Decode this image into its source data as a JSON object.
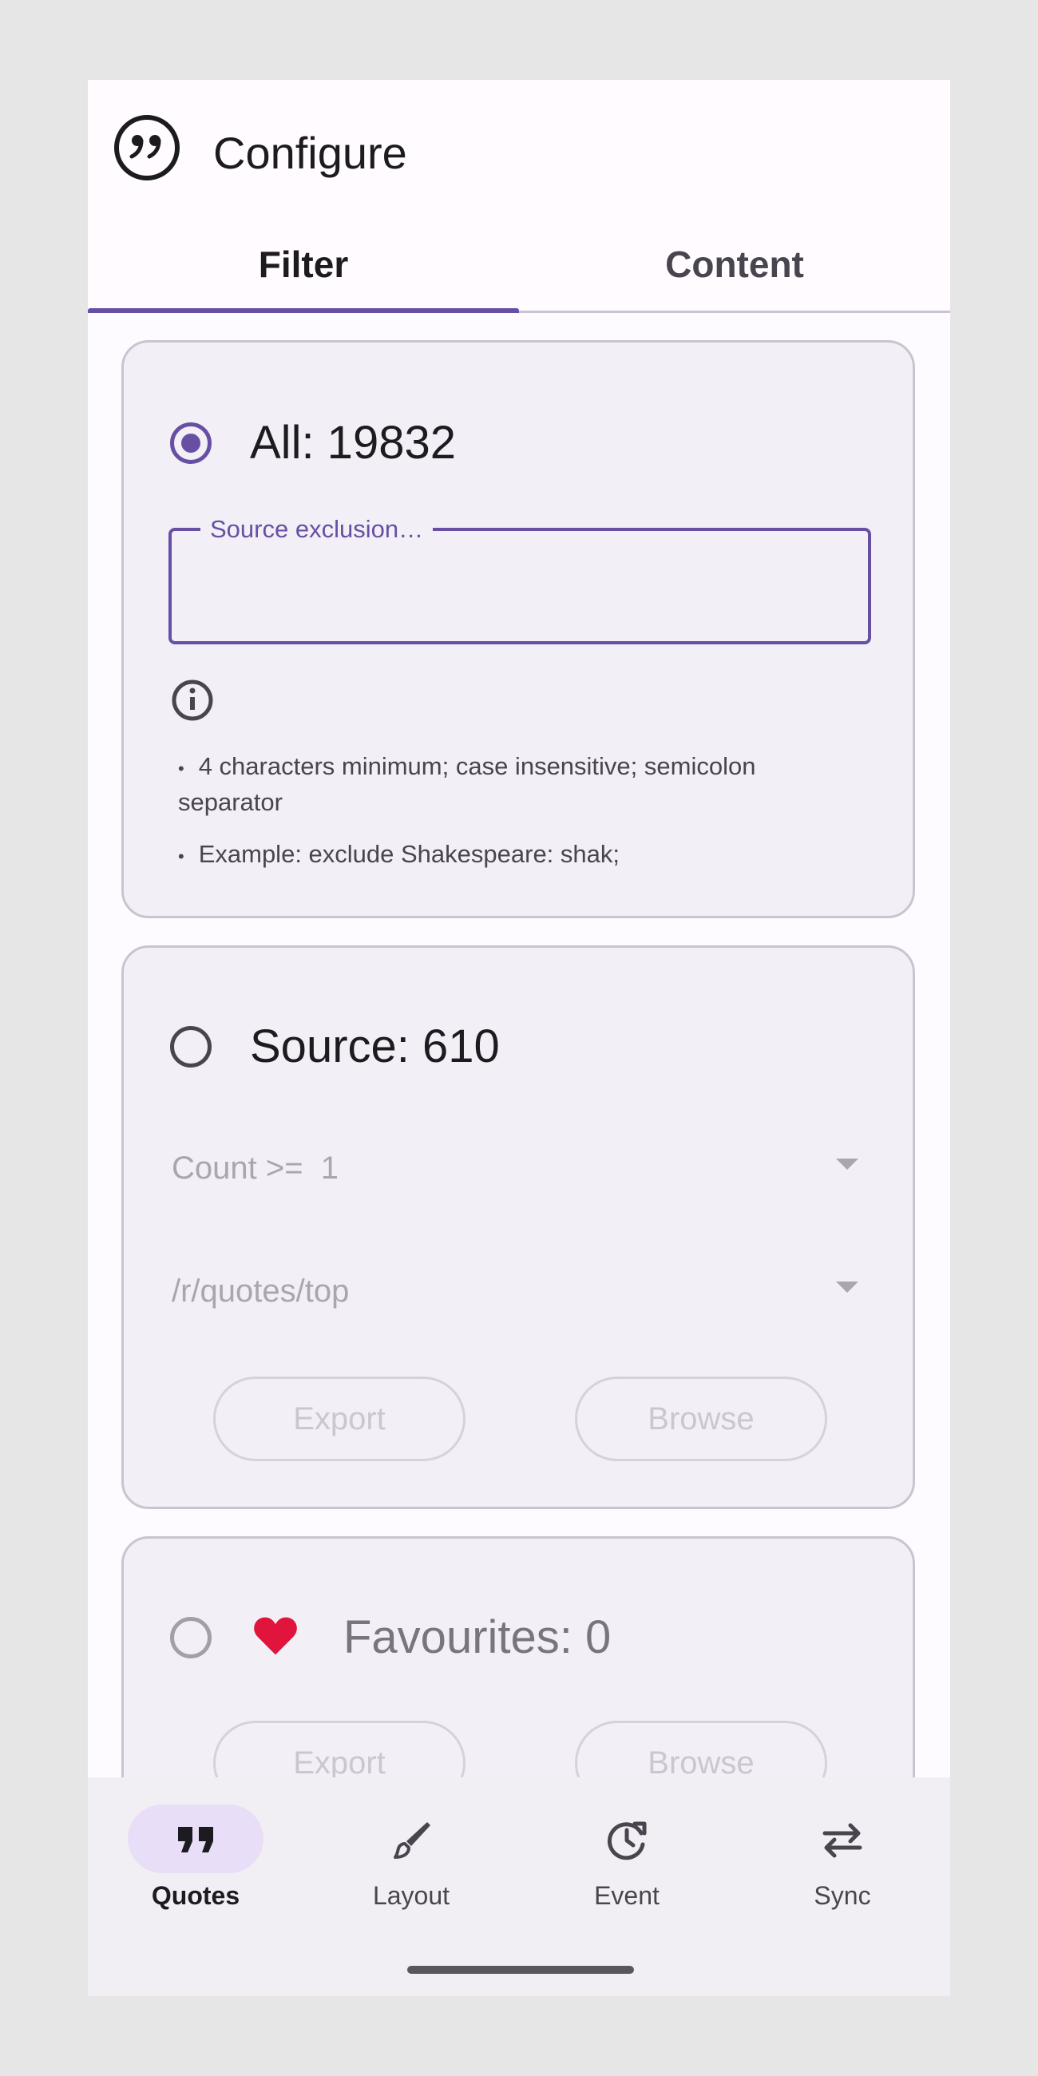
{
  "app": {
    "title": "Configure",
    "icon": "quote-bubble-icon"
  },
  "tabs": [
    {
      "label": "Filter",
      "selected": true
    },
    {
      "label": "Content",
      "selected": false
    }
  ],
  "all_card": {
    "label": "All: 19832",
    "selected": true,
    "source_exclusion": {
      "label": "Source exclusion…",
      "value": ""
    },
    "info_icon": "info-icon",
    "hints": [
      "4 characters minimum; case insensitive; semicolon separator",
      "Example: exclude Shakespeare: shak;"
    ]
  },
  "source_card": {
    "label": "Source: 610",
    "selected": false,
    "count_dropdown": {
      "label": "Count >=  1"
    },
    "source_dropdown": {
      "label": "/r/quotes/top"
    },
    "export_label": "Export",
    "browse_label": "Browse"
  },
  "favourites_card": {
    "label": "Favourites: 0",
    "selected": false,
    "heart_color": "#e0143c",
    "export_label": "Export",
    "browse_label": "Browse"
  },
  "bottom_nav": [
    {
      "label": "Quotes",
      "icon": "quotes-icon",
      "active": true
    },
    {
      "label": "Layout",
      "icon": "brush-icon",
      "active": false
    },
    {
      "label": "Event",
      "icon": "event-history-icon",
      "active": false
    },
    {
      "label": "Sync",
      "icon": "sync-arrows-icon",
      "active": false
    }
  ],
  "colors": {
    "primary": "#6750a4",
    "surface": "#f3eff7",
    "outline": "#cac4d0"
  }
}
